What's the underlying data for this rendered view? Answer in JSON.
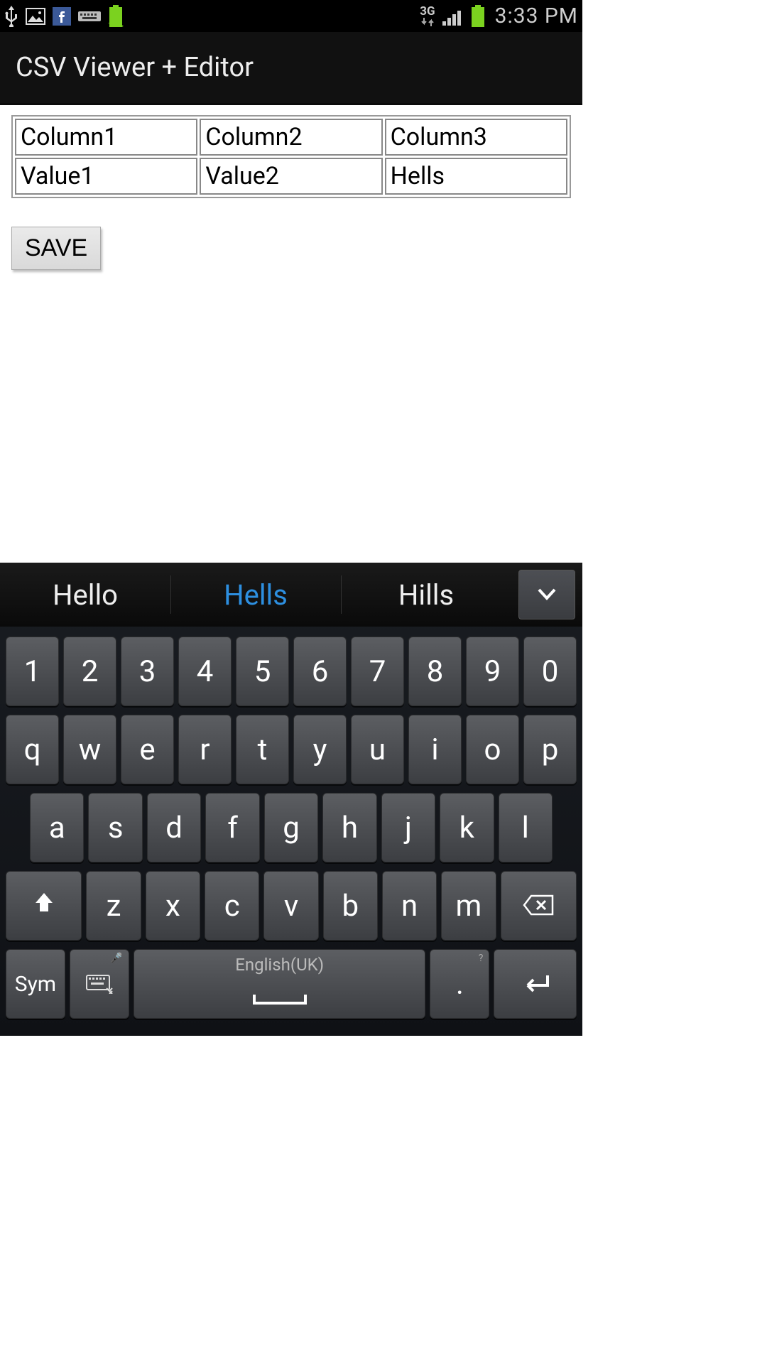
{
  "statusbar": {
    "time": "3:33 PM",
    "network_label": "3G",
    "battery_text": "100%"
  },
  "actionbar": {
    "title": "CSV Viewer + Editor"
  },
  "table": {
    "rows": [
      {
        "c0": "Column1",
        "c1": "Column2",
        "c2": "Column3"
      },
      {
        "c0": "Value1",
        "c1": "Value2",
        "c2": "Hells"
      }
    ]
  },
  "buttons": {
    "save": "SAVE"
  },
  "keyboard": {
    "suggestions": {
      "s0": "Hello",
      "s1": "Hells",
      "s2": "Hills"
    },
    "space_language": "English(UK)",
    "sym_label": "Sym",
    "period_key": ".",
    "period_key_alt": "?",
    "settings_key_alt": "🎤",
    "row_num": {
      "k0": "1",
      "k1": "2",
      "k2": "3",
      "k3": "4",
      "k4": "5",
      "k5": "6",
      "k6": "7",
      "k7": "8",
      "k8": "9",
      "k9": "0"
    },
    "row_q": {
      "k0": "q",
      "k1": "w",
      "k2": "e",
      "k3": "r",
      "k4": "t",
      "k5": "y",
      "k6": "u",
      "k7": "i",
      "k8": "o",
      "k9": "p"
    },
    "row_a": {
      "k0": "a",
      "k1": "s",
      "k2": "d",
      "k3": "f",
      "k4": "g",
      "k5": "h",
      "k6": "j",
      "k7": "k",
      "k8": "l"
    },
    "row_z": {
      "k0": "z",
      "k1": "x",
      "k2": "c",
      "k3": "v",
      "k4": "b",
      "k5": "n",
      "k6": "m"
    }
  }
}
